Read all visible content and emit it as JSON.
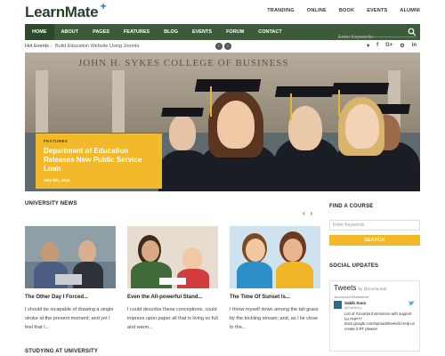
{
  "logo": {
    "text": "LearnMate",
    "plus": "+"
  },
  "topnav": [
    "TRANDING",
    "ONLINE",
    "BOOK",
    "EVENTS",
    "ALUMNI"
  ],
  "mainnav": {
    "items": [
      "HOME",
      "ABOUT",
      "PAGES",
      "FEATURES",
      "BLOG",
      "EVENTS",
      "FORUM",
      "CONTACT"
    ],
    "active_index": 0,
    "search_placeholder": "Enter Keywords"
  },
  "hotbar": {
    "label": "Hot Events :",
    "text": "Build Education Website Using Joomla",
    "social": [
      "▾",
      "f",
      "G+",
      "⚙",
      "in"
    ]
  },
  "hero": {
    "building_text": "JOHN H. SYKES COLLEGE OF BUSINESS",
    "feature_tag": "FEATURES",
    "feature_title": "Department of Education Releases New Public Service Loan",
    "feature_date": "July 8th, 2016"
  },
  "university_news": {
    "heading": "UNIVERSITY NEWS",
    "cards": [
      {
        "title": "The Other Day I Forced...",
        "desc": "I should be incapable of drawing a single stroke at the present moment; and yet I feel that I..."
      },
      {
        "title": "Even the All-powerful Stand...",
        "desc": "I could describe these conceptions, could impress upon paper all that is living so full and warm..."
      },
      {
        "title": "The Time Of Sunset Is...",
        "desc": "I throw myself down among the tall grass by the trickling stream; and, as I lie close to the..."
      }
    ]
  },
  "studying": {
    "heading": "STUDYING AT UNIVERSITY"
  },
  "sidebar": {
    "find_course": "FIND A COURSE",
    "input_placeholder": "Enter Keywords",
    "search_button": "SEARCH",
    "social_updates": "SOCIAL UPDATES",
    "tweets": {
      "title": "Tweets",
      "by": "by @JoomLead",
      "retweet": "JoomLead Retweeted",
      "name": "Sakib Suvo",
      "handle": "@SakibSu",
      "body": "List of #Joomla Extensions with support for PHP7? docs.google.com/spreadsheets/d Help us create it RT please!"
    }
  },
  "colors": {
    "nav": "#3d5a3b",
    "accent": "#f2b92a"
  }
}
